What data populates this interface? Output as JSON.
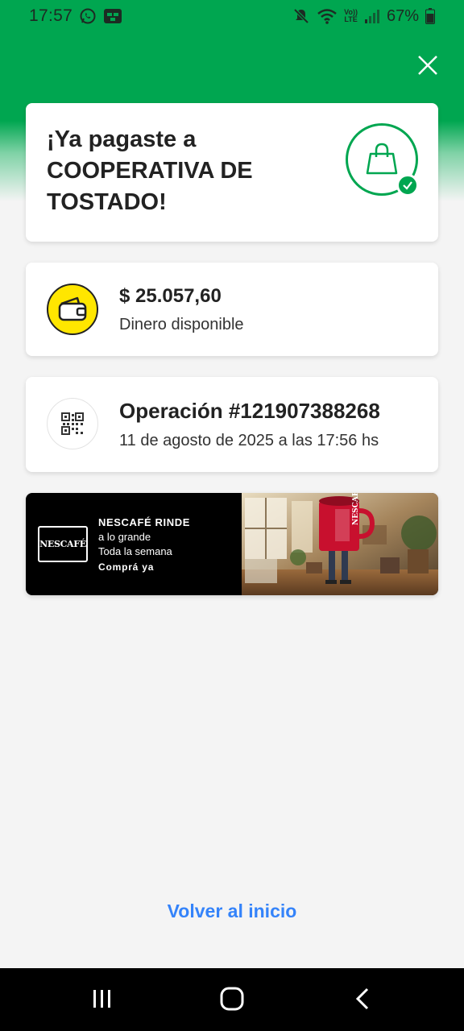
{
  "status_bar": {
    "time": "17:57",
    "battery_percent": "67%",
    "icons": [
      "whatsapp-icon",
      "app-notification-icon",
      "mute-icon",
      "wifi-icon",
      "volte-icon",
      "signal-icon",
      "battery-icon"
    ],
    "volte_label_top": "Vo))",
    "volte_label_bottom": "LTE"
  },
  "colors": {
    "brand_green": "#00a650",
    "link_blue": "#3483fa",
    "wallet_yellow": "#ffe600"
  },
  "success_card": {
    "title": "¡Ya pagaste a COOPERATIVA DE TOSTADO!",
    "icon": "shopping-bag-icon",
    "badge_icon": "check-icon"
  },
  "balance_card": {
    "amount": "$ 25.057,60",
    "label": "Dinero disponible",
    "icon": "wallet-icon"
  },
  "operation_card": {
    "title": "Operación #121907388268",
    "date": "11 de agosto de 2025 a las 17:56 hs",
    "icon": "qr-code-icon"
  },
  "banner": {
    "logo_text": "NESCAFÉ",
    "headline": "NESCAFÉ RINDE",
    "line1": "a lo grande",
    "line2": "Toda la semana",
    "cta": "Comprá ya",
    "mug_text": "NESCAFÉ"
  },
  "footer": {
    "back_link": "Volver al inicio"
  },
  "navigation_bar": {
    "buttons": [
      "recent-apps-icon",
      "home-icon",
      "back-icon"
    ]
  }
}
